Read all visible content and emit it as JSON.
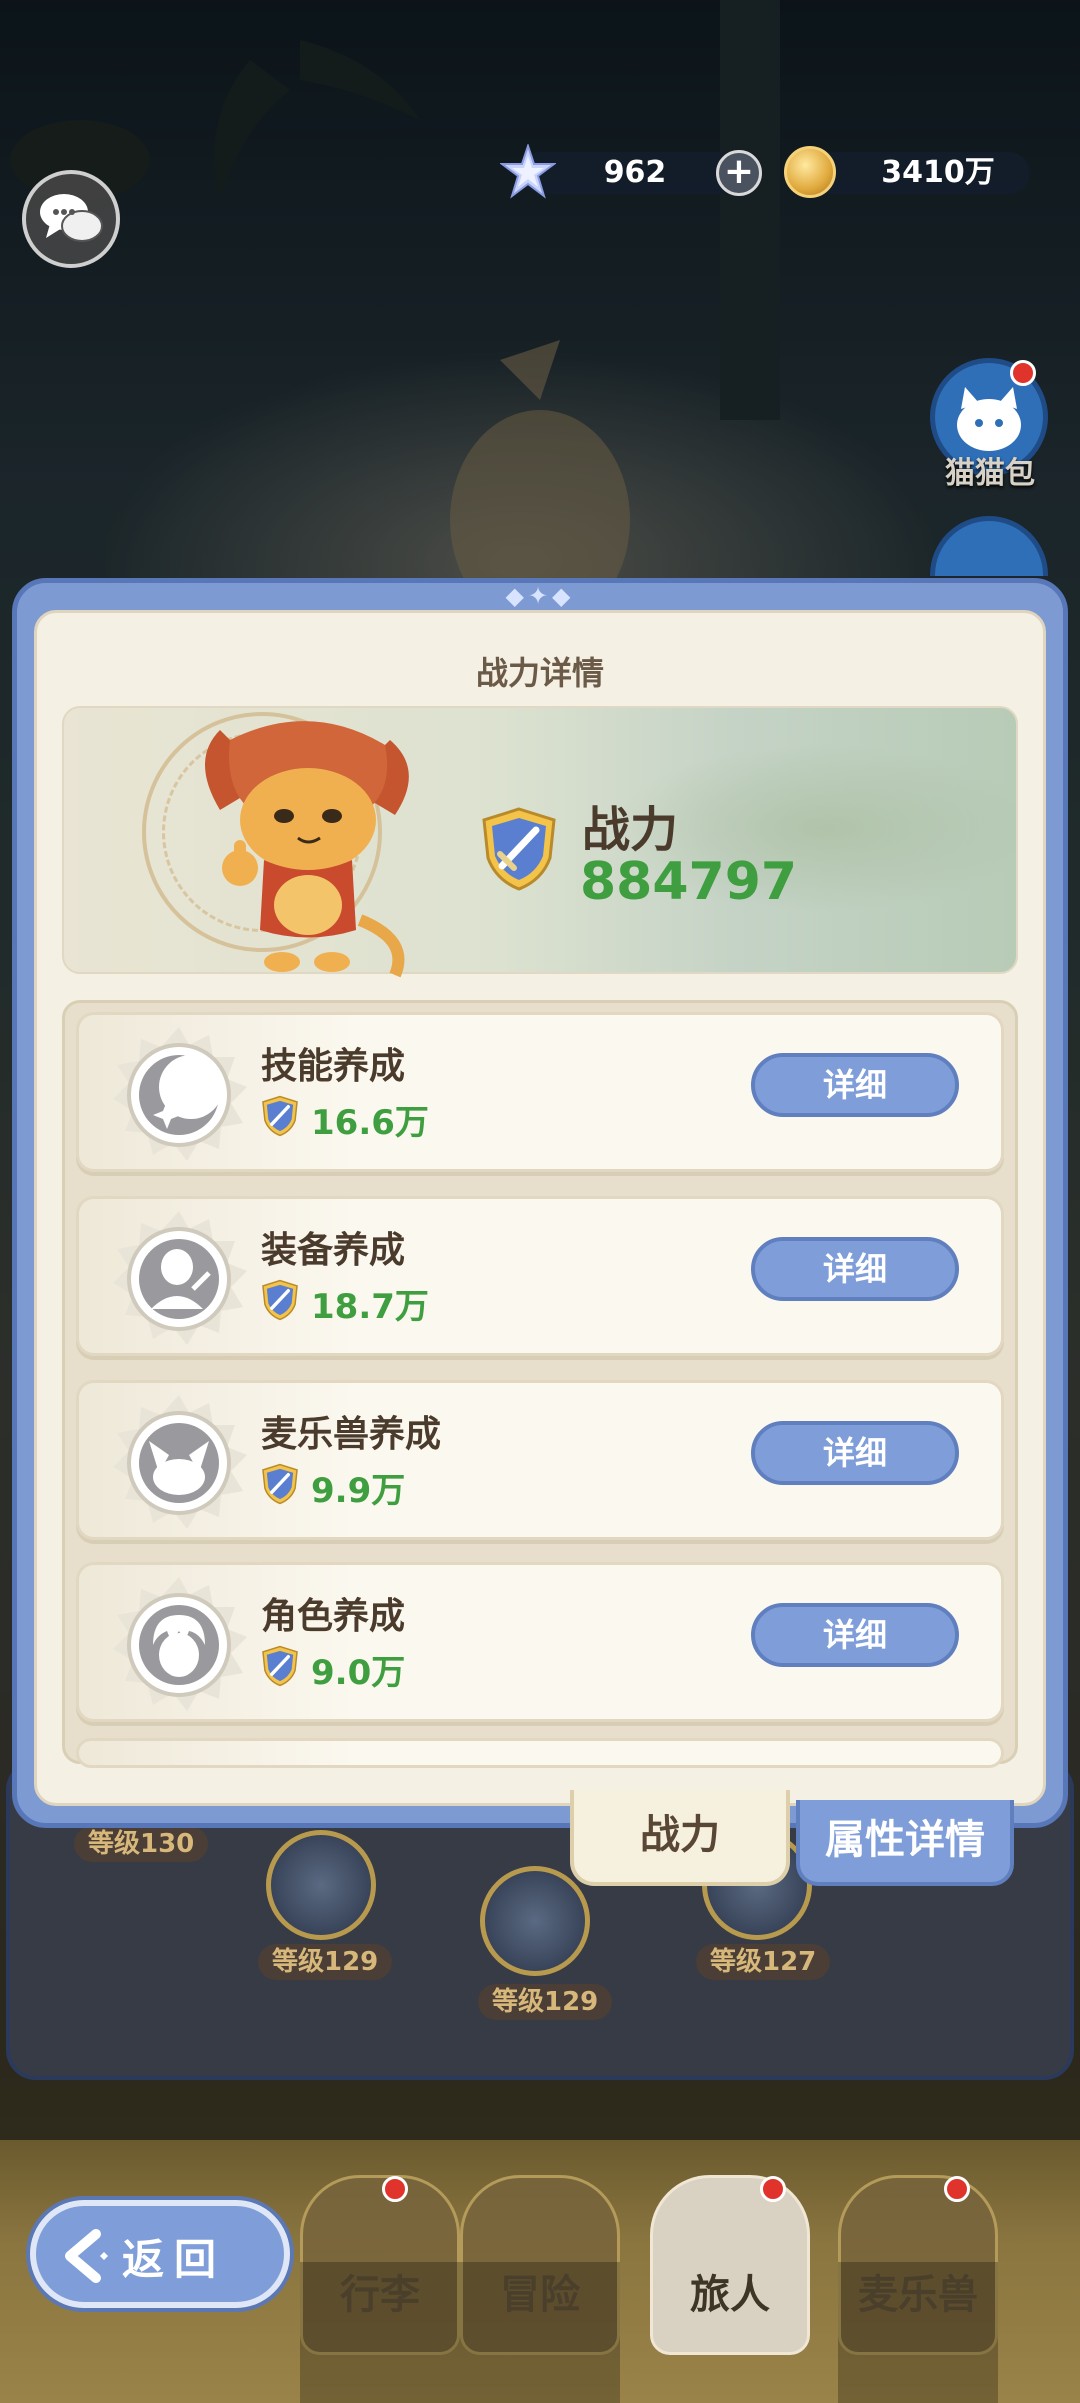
{
  "currency": {
    "gems": "962",
    "gold": "3410万"
  },
  "side_menu": {
    "cat_bag_label": "猫猫包"
  },
  "panel": {
    "title": "战力详情",
    "power_label": "战力",
    "power_value": "884797"
  },
  "categories": [
    {
      "name": "技能养成",
      "value": "16.6万",
      "button": "详细",
      "icon": "skill-moon-icon"
    },
    {
      "name": "装备养成",
      "value": "18.7万",
      "button": "详细",
      "icon": "equipment-icon"
    },
    {
      "name": "麦乐兽养成",
      "value": "9.9万",
      "button": "详细",
      "icon": "pet-cat-icon"
    },
    {
      "name": "角色养成",
      "value": "9.0万",
      "button": "详细",
      "icon": "character-icon"
    }
  ],
  "tabs": {
    "power": "战力",
    "attributes": "属性详情"
  },
  "background_levels": [
    "等级130",
    "等级129",
    "等级129",
    "等级127"
  ],
  "nav": {
    "back": "返回",
    "items": [
      "行李",
      "冒险",
      "旅人",
      "麦乐兽"
    ]
  },
  "colors": {
    "accent_blue": "#7f9ed9",
    "power_green": "#3f9e3f",
    "panel_cream": "#f5f0e4"
  }
}
